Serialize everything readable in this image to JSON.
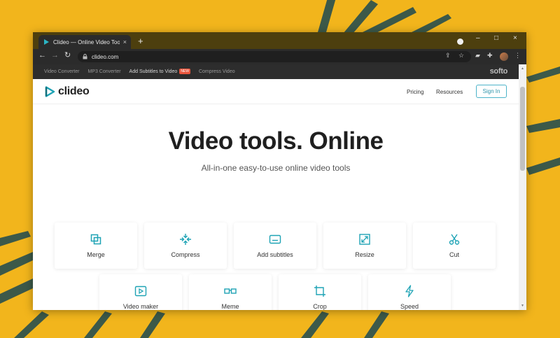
{
  "browser": {
    "tab_title": "Clideo — Online Video Tools",
    "tab_close": "×",
    "new_tab": "+",
    "url": "clideo.com",
    "window_controls": {
      "minimize": "–",
      "maximize": "□",
      "close": "×"
    }
  },
  "softo_bar": {
    "links": [
      "Video Converter",
      "MP3 Converter",
      "Add Subtitles to Video",
      "Compress Video"
    ],
    "new_badge": "NEW",
    "brand": "softo"
  },
  "site": {
    "logo": "clideo",
    "nav": {
      "pricing": "Pricing",
      "resources": "Resources",
      "sign_in": "Sign In"
    },
    "hero_title": "Video tools. Online",
    "hero_subtitle": "All-in-one easy-to-use online video tools",
    "tools_row1": [
      {
        "label": "Merge",
        "icon": "merge-icon"
      },
      {
        "label": "Compress",
        "icon": "compress-icon"
      },
      {
        "label": "Add subtitles",
        "icon": "subtitles-icon"
      },
      {
        "label": "Resize",
        "icon": "resize-icon"
      },
      {
        "label": "Cut",
        "icon": "scissors-icon"
      }
    ],
    "tools_row2": [
      {
        "label": "Video maker",
        "icon": "play-icon"
      },
      {
        "label": "Meme",
        "icon": "glasses-icon"
      },
      {
        "label": "Crop",
        "icon": "crop-icon"
      },
      {
        "label": "Speed",
        "icon": "lightning-icon"
      }
    ]
  },
  "colors": {
    "accent": "#1ea3b5",
    "titlebar": "#4d3f0e",
    "wallpaper": "#f2b51c"
  }
}
